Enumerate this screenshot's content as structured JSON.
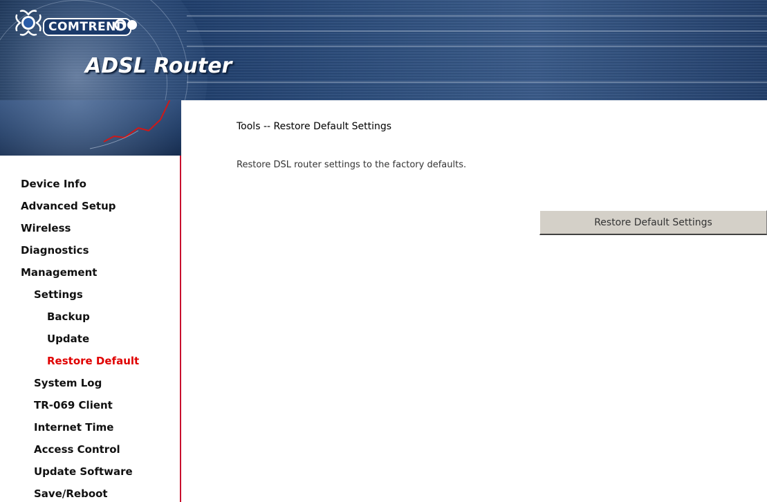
{
  "header": {
    "brand": "COMTREND",
    "product": "ADSL Router"
  },
  "page": {
    "title": "Tools -- Restore Default Settings",
    "description": "Restore DSL router settings to the factory defaults.",
    "restore_button_label": "Restore Default Settings"
  },
  "sidebar": {
    "items": [
      {
        "label": "Device Info",
        "level": 0
      },
      {
        "label": "Advanced Setup",
        "level": 0
      },
      {
        "label": "Wireless",
        "level": 0
      },
      {
        "label": "Diagnostics",
        "level": 0
      },
      {
        "label": "Management",
        "level": 0
      },
      {
        "label": "Settings",
        "level": 1
      },
      {
        "label": "Backup",
        "level": 2
      },
      {
        "label": "Update",
        "level": 2
      },
      {
        "label": "Restore Default",
        "level": 2,
        "active": true
      },
      {
        "label": "System Log",
        "level": 1
      },
      {
        "label": "TR-069 Client",
        "level": 1
      },
      {
        "label": "Internet Time",
        "level": 1
      },
      {
        "label": "Access Control",
        "level": 1
      },
      {
        "label": "Update Software",
        "level": 1
      },
      {
        "label": "Save/Reboot",
        "level": 1
      }
    ]
  },
  "colors": {
    "active_menu": "#e00000",
    "sidebar_border": "#c8102e",
    "header_dark": "#1e3d6b"
  }
}
